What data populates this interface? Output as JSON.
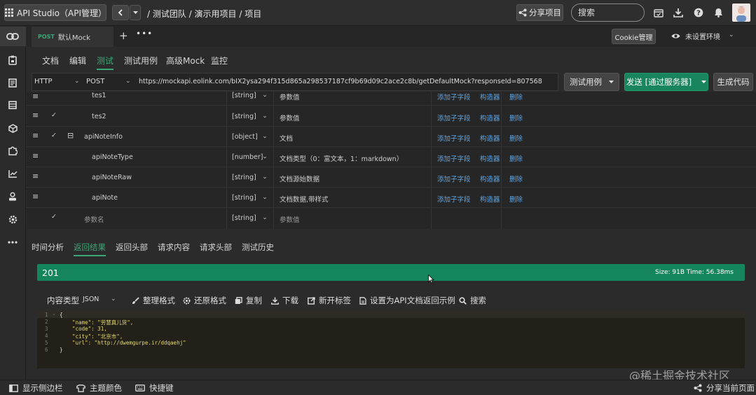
{
  "app": {
    "title": "API Studio（API管理）"
  },
  "breadcrumb": "/ 测试团队 / 演示用项目 / 项目",
  "header": {
    "share_label": "分享项目",
    "search_placeholder": "搜索"
  },
  "file_tab": {
    "method": "POST",
    "label": "默认Mock"
  },
  "tabbar": {
    "plus": "+",
    "more": "•••"
  },
  "cookie_label": "Cookie管理",
  "env_label": "未设置环境",
  "sub_tabs": [
    "文档",
    "编辑",
    "测试",
    "测试用例",
    "高级Mock",
    "监控"
  ],
  "request": {
    "protocol": "HTTP",
    "method": "POST",
    "url": "https://mockapi.eolink.com/bIX2ysa294f315d865a298537187cf9b69d09c2ace2c8b/getDefaultMock?responseId=807568",
    "test_case_label": "测试用例",
    "send_label": "发送 [通过服务器]",
    "gen_code_label": "生成代码"
  },
  "params": [
    {
      "name": "tes1",
      "type": "[string]",
      "desc": "参数值",
      "add": "添加子字段",
      "build": "构造器",
      "del": "删除"
    },
    {
      "name": "tes2",
      "type": "[string]",
      "desc": "参数值",
      "add": "添加子字段",
      "build": "构造器",
      "del": "删除"
    },
    {
      "name": "apiNoteInfo",
      "type": "[object]",
      "desc": "文档",
      "add": "添加子字段",
      "build": "构造器",
      "del": "删除"
    },
    {
      "name": "apiNoteType",
      "type": "[number]",
      "desc": "文档类型（0：富文本，1：markdown）",
      "add": "添加子字段",
      "build": "构造器",
      "del": "删除"
    },
    {
      "name": "apiNoteRaw",
      "type": "[string]",
      "desc": "文档源始数据",
      "add": "添加子字段",
      "build": "构造器",
      "del": "删除"
    },
    {
      "name": "apiNote",
      "type": "[string]",
      "desc": "文档数据,带样式",
      "add": "添加子字段",
      "build": "构造器",
      "del": "删除"
    },
    {
      "name": "参数名",
      "type": "[string]",
      "desc": "参数值"
    }
  ],
  "response_tabs": [
    "时间分析",
    "返回结果",
    "返回头部",
    "请求内容",
    "请求头部",
    "测试历史"
  ],
  "status": {
    "code": "201",
    "meta": "Size:  91B      Time:  56.38ms"
  },
  "tools": {
    "content_type_label": "内容类型",
    "content_type_value": "JSON",
    "format": "整理格式",
    "restore": "还原格式",
    "copy": "复制",
    "download": "下载",
    "new_tab": "新开标签",
    "set_example": "设置为API文档返回示例",
    "search": "搜索"
  },
  "code": {
    "line_numbers": [
      "1",
      "2",
      "3",
      "4",
      "5",
      "6"
    ],
    "lines": [
      "{",
      "    \"name\": \"劳慧真儿货\",",
      "    \"code\": 31,",
      "    \"city\": \"北京市\",",
      "    \"url\": \"http://dwemgurpe.ir/ddqaehj\"",
      "}"
    ]
  },
  "bottom": {
    "sidebar": "显示侧边栏",
    "theme": "主题颜色",
    "shortcut": "快捷键",
    "share_page": "分享当前页面"
  },
  "watermark": "@稀土掘金技术社区",
  "colors": {
    "accent": "#19855c",
    "link": "#5ba6e8",
    "bg": "#2b2b2b"
  }
}
